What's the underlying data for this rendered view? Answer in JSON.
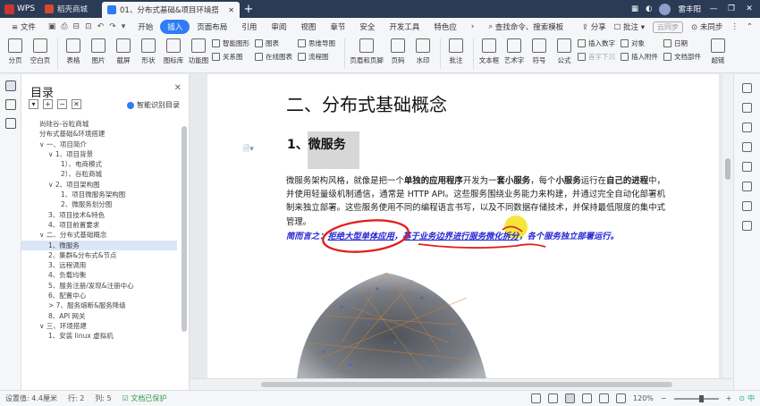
{
  "titlebar": {
    "app": "WPS",
    "tabs": [
      {
        "label": "稻壳商城",
        "color": "#d9472f"
      },
      {
        "label": "01、分布式基础&项目环境搭建",
        "color": "#2f7cf6"
      }
    ],
    "new_tab": "+",
    "user": "雷丰阳"
  },
  "menubar": {
    "file": "≡ 文件",
    "items": [
      "开始",
      "插入",
      "页面布局",
      "引用",
      "审阅",
      "视图",
      "章节",
      "安全",
      "开发工具",
      "特色应"
    ],
    "active": "插入",
    "search": "查找命令、搜索模板",
    "share": "分享",
    "annotate": "批注",
    "cloud": "云同步",
    "unsynced": "未同步"
  },
  "ribbon": {
    "big": [
      {
        "label": "分页"
      },
      {
        "label": "空白页"
      },
      {
        "label": "表格"
      },
      {
        "label": "图片"
      },
      {
        "label": "截屏"
      },
      {
        "label": "形状"
      },
      {
        "label": "图标库"
      },
      {
        "label": "功能图"
      }
    ],
    "small_a": [
      "智能图形",
      "关系图"
    ],
    "small_b": [
      "图表",
      "在线图表"
    ],
    "small_c": [
      "思维导图",
      "流程图"
    ],
    "big2": [
      {
        "label": "页眉和页脚"
      },
      {
        "label": "页码"
      },
      {
        "label": "水印"
      },
      {
        "label": "批注"
      },
      {
        "label": "文本框"
      },
      {
        "label": "艺术字"
      },
      {
        "label": "符号"
      },
      {
        "label": "公式"
      }
    ],
    "small_d": [
      "插入数字",
      "首字下沉"
    ],
    "small_e": [
      "对象",
      "插入附件"
    ],
    "small_f": [
      "日期",
      "文档部件"
    ],
    "last": "超链"
  },
  "toc": {
    "title": "目录",
    "smart": "智能识别目录",
    "items": [
      {
        "text": "尚硅谷-谷粒商城",
        "indent": 0
      },
      {
        "text": "分布式基础&环境搭建",
        "indent": 0
      },
      {
        "text": "∨ 一、项目简介",
        "indent": 1
      },
      {
        "text": "∨ 1、项目背景",
        "indent": 2
      },
      {
        "text": "1）、电商模式",
        "indent": 3
      },
      {
        "text": "2）、谷粒商城",
        "indent": 3
      },
      {
        "text": "∨ 2、项目架构图",
        "indent": 2
      },
      {
        "text": "1、项目微服务架构图",
        "indent": 3
      },
      {
        "text": "2、微服务划分图",
        "indent": 3
      },
      {
        "text": "3、项目技术&特色",
        "indent": 2
      },
      {
        "text": "4、项目前置要求",
        "indent": 2
      },
      {
        "text": "∨ 二、分布式基础概念",
        "indent": 1
      },
      {
        "text": "1、微服务",
        "indent": 2,
        "selected": true
      },
      {
        "text": "2、集群&分布式&节点",
        "indent": 2
      },
      {
        "text": "3、远程调用",
        "indent": 2
      },
      {
        "text": "4、负载均衡",
        "indent": 2
      },
      {
        "text": "5、服务注册/发现&注册中心",
        "indent": 2
      },
      {
        "text": "6、配置中心",
        "indent": 2
      },
      {
        "text": "> 7、服务熔断&服务降级",
        "indent": 2
      },
      {
        "text": "8、API 网关",
        "indent": 2
      },
      {
        "text": "∨ 三、环境搭建",
        "indent": 1
      },
      {
        "text": "1、安装 linux 虚拟机",
        "indent": 2
      }
    ]
  },
  "doc": {
    "h1": "二、分布式基础概念",
    "h2": "1、微服务",
    "para_parts": [
      {
        "t": "微服务架构风格，就像是把一个",
        "b": false
      },
      {
        "t": "单独的应用程序",
        "b": true
      },
      {
        "t": "开发为一",
        "b": false
      },
      {
        "t": "套小服务",
        "b": true
      },
      {
        "t": "，每个",
        "b": false
      },
      {
        "t": "小服务",
        "b": true
      },
      {
        "t": "运行在",
        "b": false
      },
      {
        "t": "自己的进程",
        "b": true
      },
      {
        "t": "中，并使用轻量级机制通信，通常是 HTTP API。这些服务围绕业务能力来构建，并通过完全自动化部署机制来独立部署。这些服务使用不同的编程语言书写，以及不同数据存储技术，并保持最低限度的集中式管理。",
        "b": false
      }
    ],
    "summary_lead": "简而言之：",
    "summary_u1": "拒绝大型单体应用",
    "summary_mid": "，",
    "summary_u2": "基于业务边界进行服务微化拆分",
    "summary_tail": "，各个服务独立部署运行。"
  },
  "statusbar": {
    "setting": "设置值: 4.4厘米",
    "row": "行: 2",
    "col": "列: 5",
    "protect": "文档已保护",
    "zoom": "120%",
    "zoom_out": "−",
    "zoom_in": "+",
    "ime": "中"
  }
}
